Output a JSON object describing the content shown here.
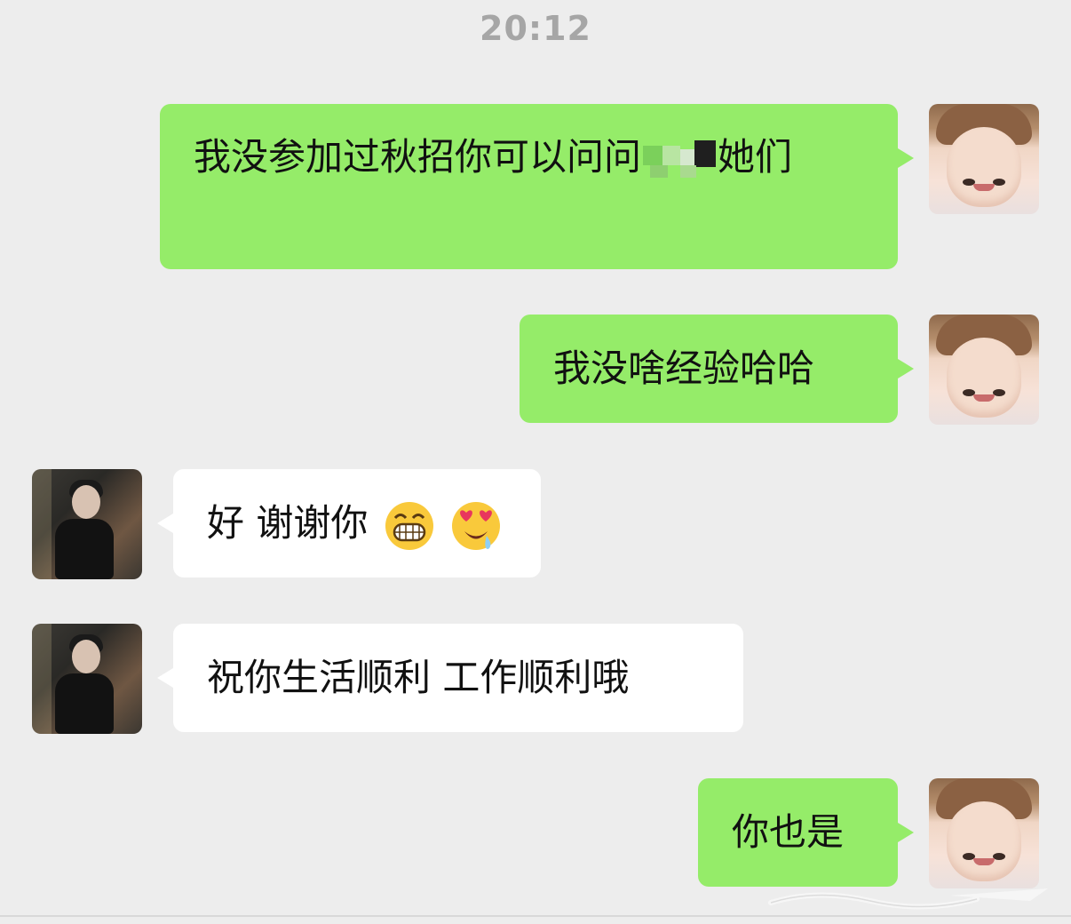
{
  "time": "20:12",
  "messages": [
    {
      "side": "right",
      "text_before": "我没参加过秋招你可以问问",
      "text_after": "她们"
    },
    {
      "side": "right",
      "text": "我没啥经验哈哈"
    },
    {
      "side": "left",
      "text": "好 谢谢你",
      "emojis": [
        "grinning-face-emoji",
        "heart-eyes-drooling-emoji"
      ]
    },
    {
      "side": "left",
      "text": "祝你生活顺利 工作顺利哦"
    },
    {
      "side": "right",
      "text": "你也是"
    }
  ],
  "icons": {
    "self_avatar": "self-avatar-photo",
    "friend_avatar": "friend-avatar-photo"
  }
}
